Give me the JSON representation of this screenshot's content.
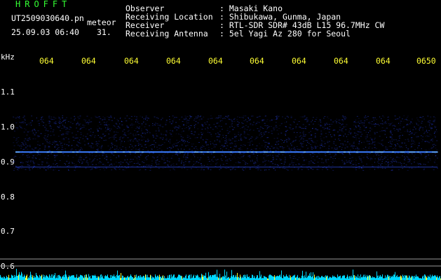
{
  "header": {
    "app_name": "HROFFT",
    "filename": "UT2509030640.pn",
    "meteor_label": "meteor",
    "datetime": "25.09.03 06:40",
    "count": "31.",
    "info": [
      {
        "label": "Observer",
        "value": ": Masaki Kano"
      },
      {
        "label": "Receiving Location",
        "value": ": Shibukawa, Gunma, Japan"
      },
      {
        "label": "Receiver",
        "value": ": RTL-SDR SDR# 43dB L15 96.7MHz CW"
      },
      {
        "label": "Receiving Antenna",
        "value": ": 5el Yagi Az 280 for Seoul"
      }
    ]
  },
  "y_axis": {
    "unit": "kHz",
    "ticks": [
      "1.1",
      "1.0",
      "0.9",
      "0.8",
      "0.7",
      "0.6"
    ],
    "range": [
      0.6,
      1.1
    ]
  },
  "x_axis": {
    "ticks": [
      "064",
      "064",
      "064",
      "064",
      "064",
      "064",
      "064",
      "064",
      "064",
      "0650"
    ]
  },
  "signal": {
    "carrier_khz": 0.873,
    "secondary_khz": 0.838,
    "noise_band_khz": [
      0.83,
      0.96
    ]
  },
  "colors": {
    "background": "#000000",
    "text": "#ffffff",
    "title": "#33ff33",
    "axis_labels": "#ffff33",
    "carrier": "#3a7cff",
    "amplitude": "#00d8ff"
  }
}
